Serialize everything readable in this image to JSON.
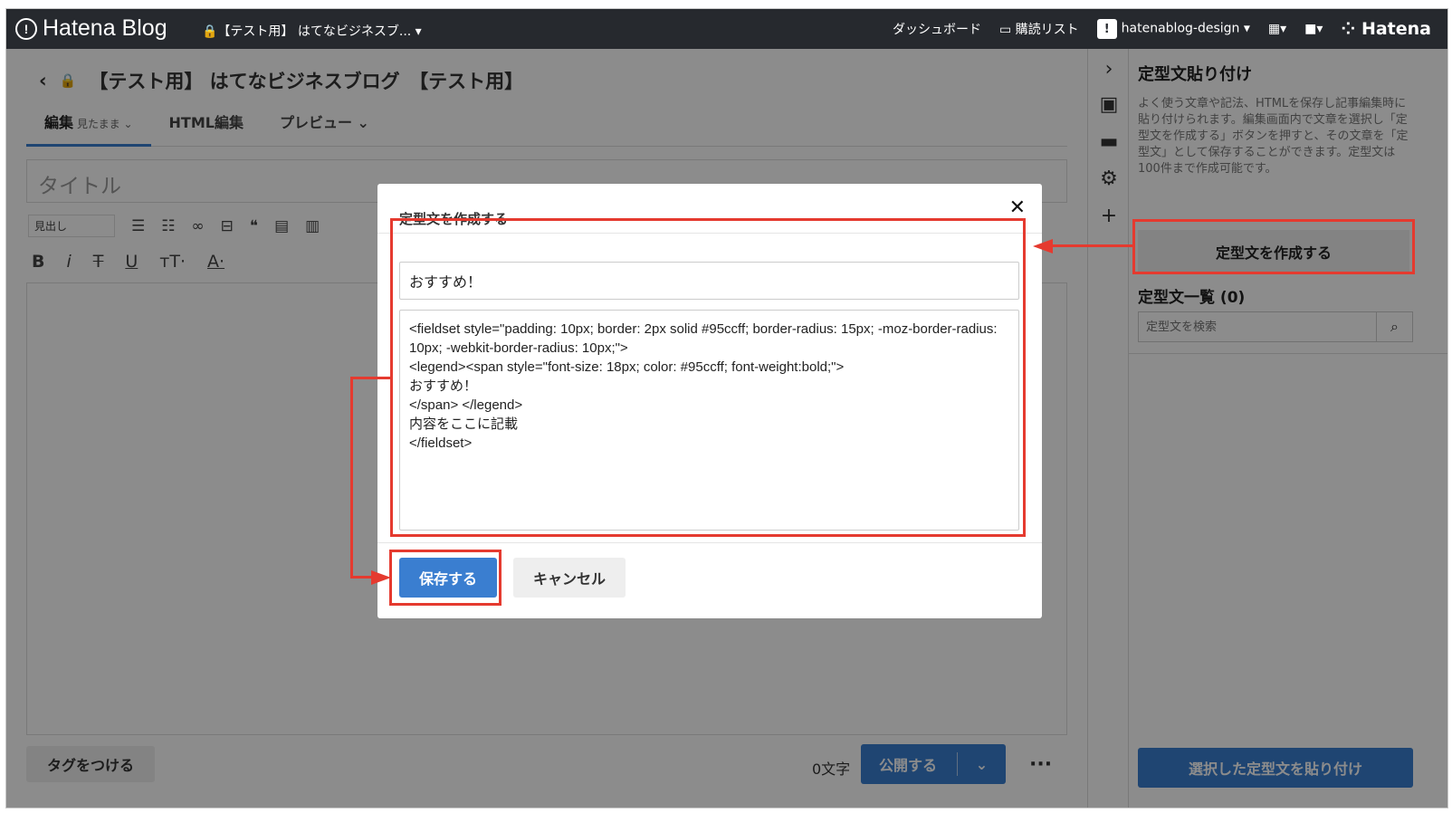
{
  "topbar": {
    "brand": "Hatena Blog",
    "blog_selector": "🔒【テスト用】 はてなビジネスブ... ▾",
    "dashboard": "ダッシュボード",
    "reading_list": "購読リスト",
    "user": "hatenablog-design ▾",
    "hatena": "Hatena"
  },
  "editor": {
    "blog_title": "【テスト用】 はてなビジネスブログ　【テスト用】",
    "tabs": [
      {
        "label": "編集",
        "sub": "見たまま ⌄"
      },
      {
        "label": "HTML編集"
      },
      {
        "label": "プレビュー ⌄"
      }
    ],
    "title_placeholder": "タイトル",
    "heading_select": "見出し",
    "add_tags": "タグをつける",
    "word_count": "0文字",
    "publish": "公開する"
  },
  "panel": {
    "title": "定型文貼り付け",
    "description": "よく使う文章や記法、HTMLを保存し記事編集時に貼り付けられます。編集画面内で文章を選択し「定型文を作成する」ボタンを押すと、その文章を「定型文」として保存することができます。定型文は100件まで作成可能です。",
    "create_button": "定型文を作成する",
    "list_title": "定型文一覧 (0)",
    "search_placeholder": "定型文を検索",
    "paste_button": "選択した定型文を貼り付け"
  },
  "modal": {
    "title": "定型文を作成する",
    "name_value": "おすすめ！",
    "code_value": "<fieldset style=\"padding: 10px; border: 2px solid #95ccff; border-radius: 15px; -moz-border-radius: 10px; -webkit-border-radius: 10px;\">\n<legend><span style=\"font-size: 18px; color: #95ccff; font-weight:bold;\">\nおすすめ！\n</span> </legend>\n内容をここに記載\n</fieldset>",
    "save": "保存する",
    "cancel": "キャンセル"
  },
  "colors": {
    "accent": "#3a7ed0",
    "topbar": "#26292e",
    "annotation": "#e53a2f"
  }
}
